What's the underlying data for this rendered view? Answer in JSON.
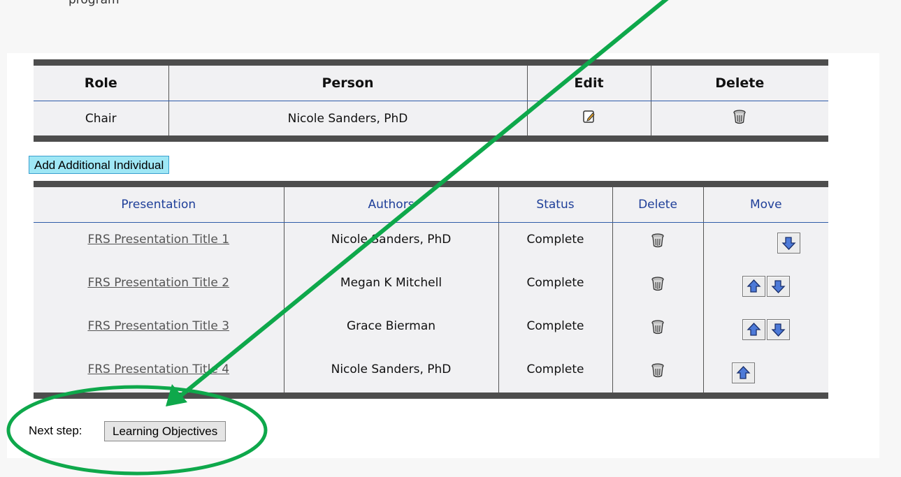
{
  "top_text": "program",
  "roles_table": {
    "headers": [
      "Role",
      "Person",
      "Edit",
      "Delete"
    ],
    "rows": [
      {
        "role": "Chair",
        "person": "Nicole Sanders, PhD"
      }
    ]
  },
  "add_button_label": "Add Additional Individual",
  "presentations_table": {
    "headers": [
      "Presentation",
      "Authors",
      "Status",
      "Delete",
      "Move"
    ],
    "rows": [
      {
        "title": "FRS Presentation Title 1",
        "authors": "Nicole Sanders, PhD",
        "status": "Complete"
      },
      {
        "title": "FRS Presentation Title 2",
        "authors": "Megan K Mitchell",
        "status": "Complete"
      },
      {
        "title": "FRS Presentation Title 3",
        "authors": "Grace Bierman",
        "status": "Complete"
      },
      {
        "title": "FRS Presentation Title 4",
        "authors": "Nicole Sanders, PhD",
        "status": "Complete"
      }
    ]
  },
  "next_step": {
    "label": "Next step:",
    "button": "Learning Objectives"
  },
  "icons": {
    "edit": "edit-note-icon",
    "delete": "trash-can-icon",
    "move_up": "arrow-up-icon",
    "move_down": "arrow-down-icon"
  },
  "colors": {
    "annotation": "#0ea84b",
    "header_link": "#1f3f99",
    "add_button_bg": "#9fe7f5",
    "table_border": "#4d4d4d"
  }
}
